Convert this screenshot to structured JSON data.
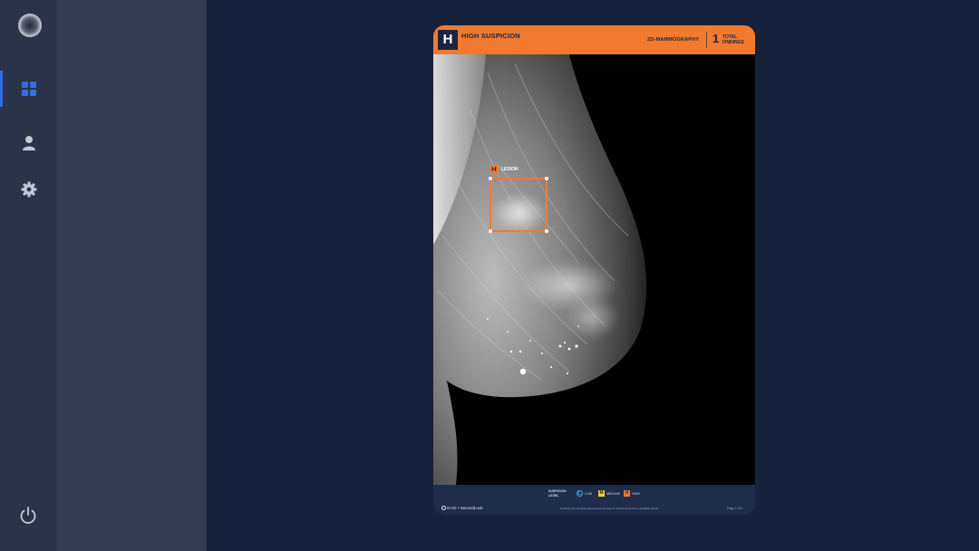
{
  "sidebar": {
    "logo_icon": "scan-logo-icon",
    "nav": [
      {
        "name": "dashboard",
        "icon": "grid-icon",
        "active": true
      },
      {
        "name": "profile",
        "icon": "user-icon",
        "active": false
      },
      {
        "name": "settings",
        "icon": "gear-icon",
        "active": false
      }
    ],
    "power_icon": "power-icon",
    "accent": "#2f6fe6"
  },
  "report": {
    "suspicion_badge": "H",
    "suspicion_label": "HIGH SUSPICION",
    "modality": "2D-MAMMOGRAPHY",
    "findings_count": "1",
    "findings_label": "TOTAL FINDINGS",
    "header_color": "#f27a2e",
    "finding": {
      "badge": "H",
      "label": "LESION"
    },
    "legend": {
      "title": "SUSPICION LEVEL",
      "items": [
        {
          "badge": "L",
          "label": "LOW",
          "color": "#3bb5e8"
        },
        {
          "badge": "M",
          "label": "MEDIUM",
          "color": "#f2d22e"
        },
        {
          "badge": "H",
          "label": "HIGH",
          "color": "#f27a2e"
        }
      ]
    },
    "brand": "iCAD • SecondLook",
    "disclaimer": "Findings are computer-generated; interpret in clinical context by a qualified reader.",
    "page": "Page 1 of 1"
  }
}
